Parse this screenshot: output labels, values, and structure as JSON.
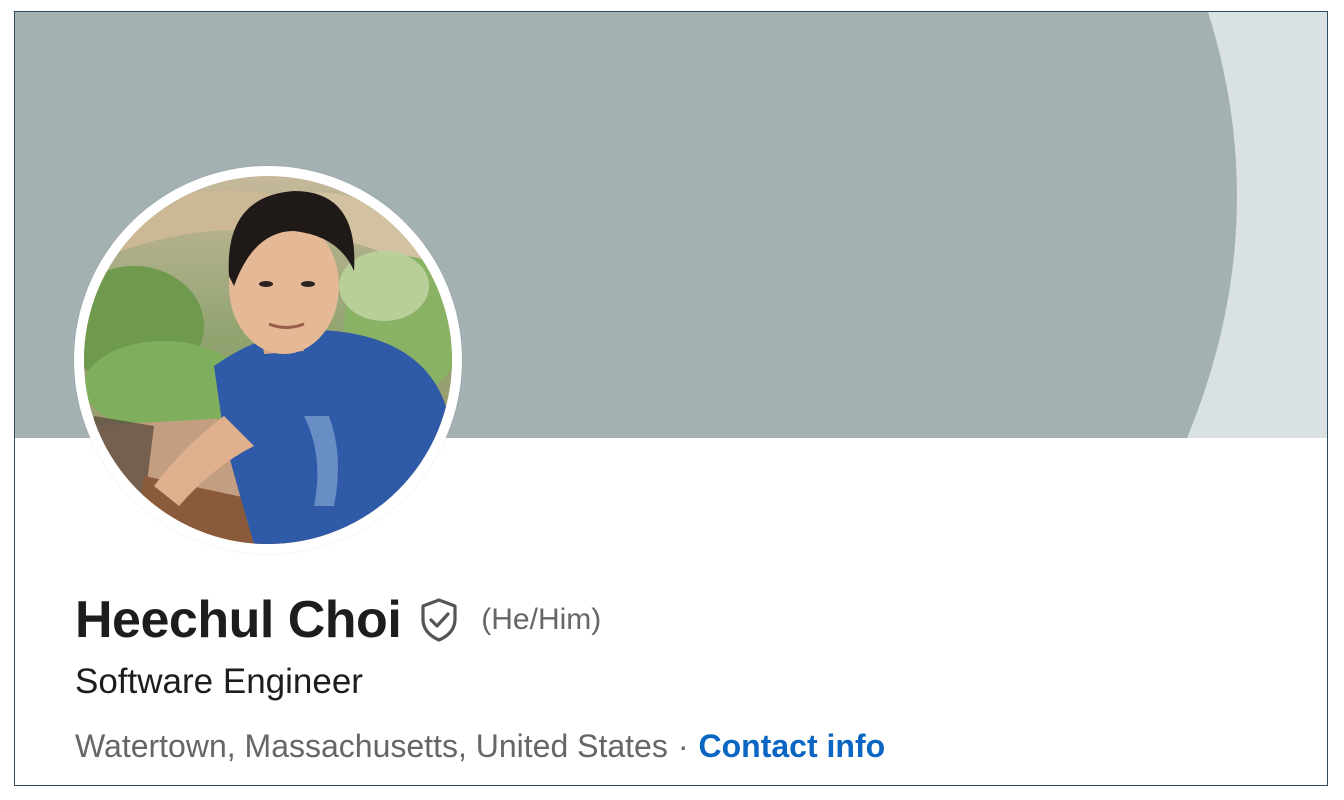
{
  "profile": {
    "name": "Heechul Choi",
    "pronouns": "(He/Him)",
    "headline": "Software Engineer",
    "location": "Watertown, Massachusetts, United States",
    "separator": "·",
    "contact_label": "Contact info"
  },
  "icons": {
    "verified": "verified-shield-icon"
  },
  "colors": {
    "banner": "#a3b1b3",
    "banner_light": "#d9e1e3",
    "link": "#0a66c2",
    "text_primary": "#1d1d1d",
    "text_secondary": "#666666",
    "border": "#2e4a5f"
  }
}
